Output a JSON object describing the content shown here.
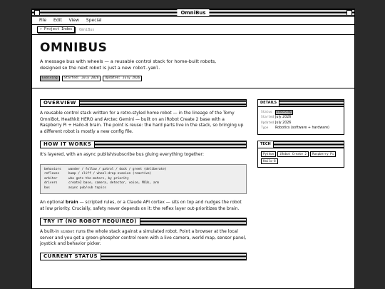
{
  "window": {
    "title": "OmniBus"
  },
  "menu": [
    "File",
    "Edit",
    "View",
    "Special"
  ],
  "breadcrumb": {
    "back_label": "← Project Index",
    "current": "OmniBus"
  },
  "hero": {
    "title": "OMNIBUS",
    "tagline_pre": "A message bus with wheels — a reusable control stack for home-built robots, designed so the next robot is just a new ",
    "tagline_code": "robot.yaml",
    "tagline_post": ".",
    "status_badge": "Evolving",
    "started": "Started: July 2026",
    "updated": "Updated: July 2026"
  },
  "sections": {
    "overview": {
      "heading": "OVERVIEW",
      "text": "A reusable control stack written for a retro-styled home robot — in the lineage of the Tomy OmniBot, Heathkit HERO and Arctec Gemini — built on an iRobot Create 2 base with a Raspberry Pi + Hailo-8 brain. The point is reuse: the hard parts live in the stack, so bringing up a different robot is mostly a new config file."
    },
    "how": {
      "heading": "HOW IT WORKS",
      "intro": "It's layered, with an async publish/subscribe bus gluing everything together:",
      "code": [
        {
          "k": "behaviors",
          "v": "wander / follow / patrol / dock / greet    (deliberate)"
        },
        {
          "k": "reflexes",
          "v": "bump / cliff / wheel-drop evasion           (reactive)"
        },
        {
          "k": "arbiter",
          "v": "who gets the motors, by priority"
        },
        {
          "k": "drivers",
          "v": "create2 base, camera, detector, voice, MCUs, arm"
        },
        {
          "k": "bus",
          "v": "async pub/sub topics"
        }
      ],
      "outro_pre": "An optional ",
      "outro_bold": "brain",
      "outro_post": " — scripted rules, or a Claude API cortex — sits on top and nudges the robot at low priority. Crucially, safety never depends on it: the reflex layer out-prioritizes the brain."
    },
    "try": {
      "heading": "TRY IT (NO ROBOT REQUIRED)",
      "text_pre": "A built-in ",
      "text_code": "simbot",
      "text_post": " runs the whole stack against a simulated robot. Point a browser at the local server and you get a green-phosphor control room with a live camera, world map, sensor panel, joystick and behavior picker."
    },
    "status": {
      "heading": "CURRENT STATUS"
    }
  },
  "details": {
    "heading": "DETAILS",
    "rows": [
      {
        "k": "Status",
        "v": "Evolving"
      },
      {
        "k": "Started",
        "v": "July 2026"
      },
      {
        "k": "Updated",
        "v": "July 2026"
      },
      {
        "k": "Type",
        "v": "Robotics (software + hardware)"
      }
    ]
  },
  "tech": {
    "heading": "TECH",
    "tags": [
      "Python",
      "iRobot Create 2",
      "Raspberry Pi",
      "Hailo-8"
    ]
  }
}
